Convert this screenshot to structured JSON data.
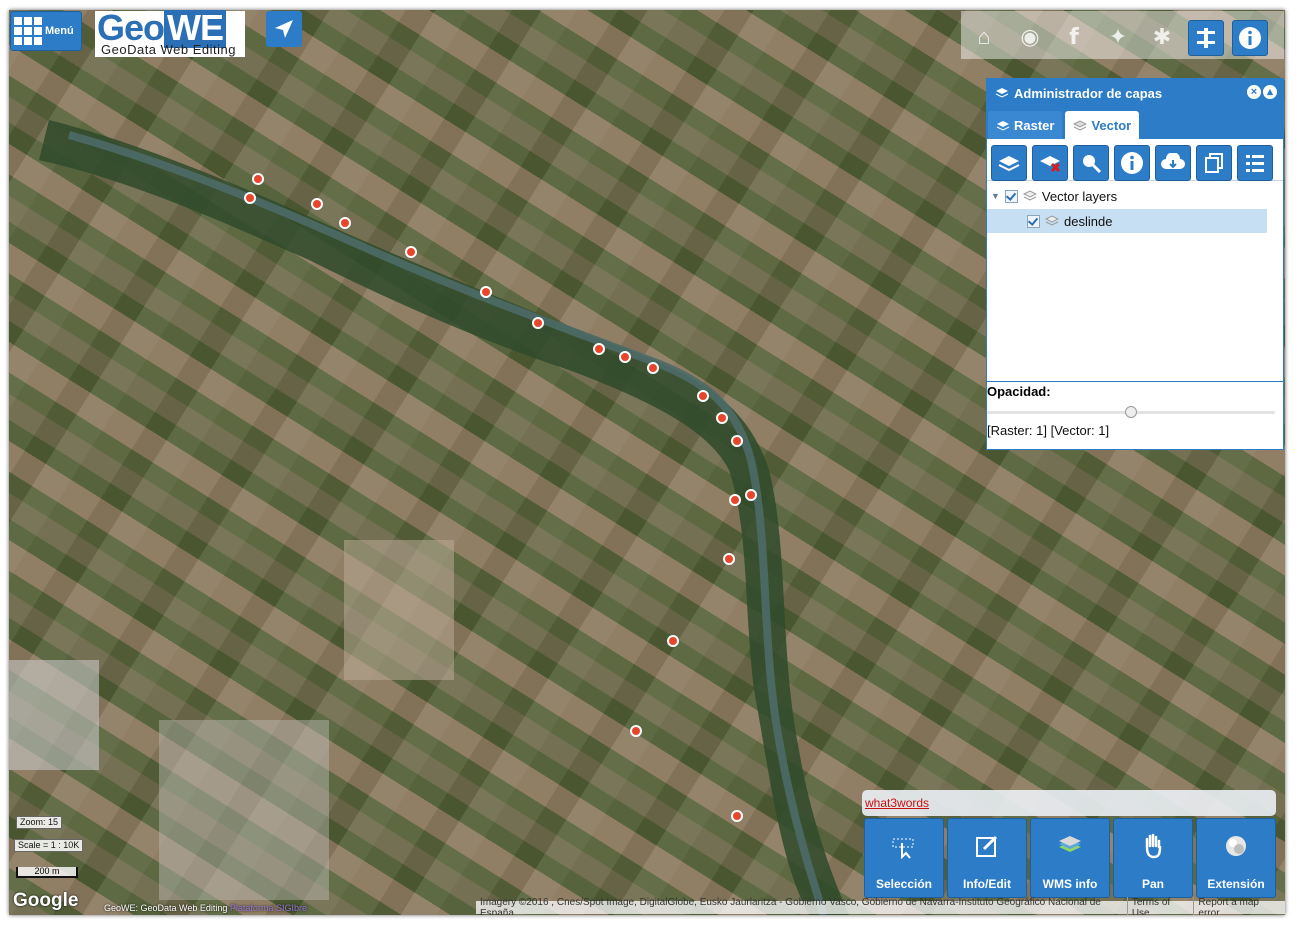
{
  "header": {
    "menu_label": "Menú",
    "logo_title_plain": "Geo",
    "logo_title_box": "WE",
    "logo_subtitle": "GeoData Web Editing"
  },
  "top_toolbar": {
    "icons": [
      "home-icon",
      "globe-icon",
      "facebook-icon",
      "twitter-icon",
      "bug-icon",
      "tools-icon",
      "info-icon"
    ]
  },
  "layer_panel": {
    "title": "Administrador de capas",
    "tabs": [
      {
        "label": "Raster"
      },
      {
        "label": "Vector"
      }
    ],
    "active_tab": "Vector",
    "tool_icons": [
      "add-layer-icon",
      "remove-layer-icon",
      "search-layer-icon",
      "info-icon",
      "download-icon",
      "copy-icon",
      "list-icon"
    ],
    "tree": {
      "group_label": "Vector layers",
      "layers": [
        {
          "label": "deslinde",
          "checked": true,
          "selected": true
        }
      ]
    },
    "opacity_label": "Opacidad:",
    "opacity_value": 0.5,
    "counts": "[Raster: 1] [Vector: 1]"
  },
  "what3words_link": "what3words",
  "bottom_toolbar": [
    {
      "label": "Selección",
      "icon": "selection-icon"
    },
    {
      "label": "Info/Edit",
      "icon": "edit-icon"
    },
    {
      "label": "WMS info",
      "icon": "wms-layers-icon"
    },
    {
      "label": "Pan",
      "icon": "hand-icon"
    },
    {
      "label": "Extensión",
      "icon": "globe-icon"
    }
  ],
  "map": {
    "zoom_label": "Zoom: 15",
    "scale_label": "Scale = 1 : 10K",
    "scalebar_label": "200 m",
    "google_logo": "Google",
    "credits_text": "GeoWE: GeoData Web Editing",
    "credits_link": "Plataforma SIGIbre",
    "attribution": "Imagery ©2016 , Cnes/Spot Image, DigitalGlobe, Eusko Jaurlaritza - Gobierno Vasco, Gobierno de Navarra-Instituto Geográfico Nacional de España",
    "terms": "Terms of Use",
    "report": "Report a map error"
  }
}
